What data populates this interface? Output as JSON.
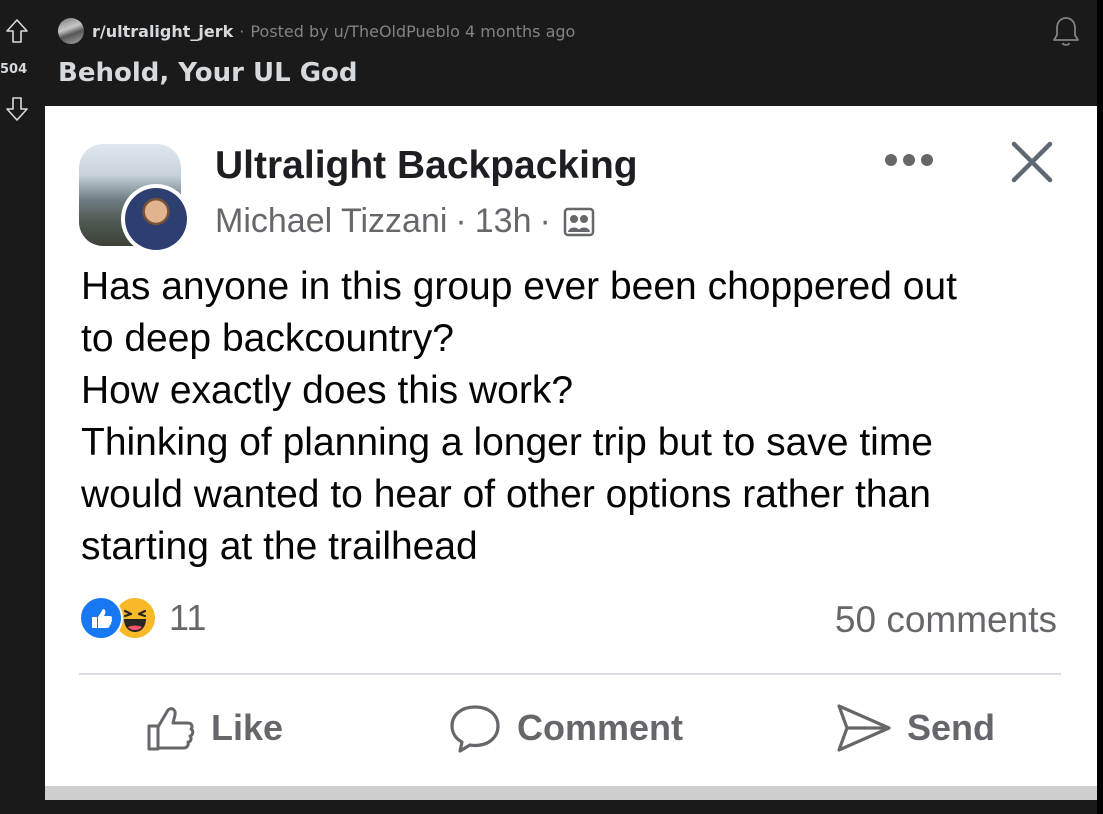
{
  "reddit": {
    "subreddit": "r/ultralight_jerk",
    "meta_sep": "·",
    "posted_by": "Posted by u/TheOldPueblo 4 months ago",
    "score": "504",
    "title": "Behold, Your UL God"
  },
  "fb_post": {
    "group_name": "Ultralight Backpacking",
    "author": "Michael Tizzani",
    "sep": "·",
    "time": "13h",
    "body": "Has anyone in this group ever been choppered out\nto deep backcountry?\nHow exactly does this work?\nThinking of planning a longer trip but to save time\nwould wanted to hear of other options rather than\nstarting at the trailhead",
    "reaction_count": "11",
    "comment_count": "50 comments",
    "actions": {
      "like": "Like",
      "comment": "Comment",
      "send": "Send"
    }
  },
  "icons": [
    "upvote-icon",
    "downvote-icon",
    "bell-icon",
    "more-icon",
    "close-icon",
    "group-audience-icon",
    "like-reaction-icon",
    "haha-reaction-icon",
    "thumbs-up-icon",
    "comment-icon",
    "send-icon"
  ],
  "colors": {
    "reddit_bg": "#1a1a1b",
    "fb_blue": "#1877f2",
    "haha_yellow": "#f7b928",
    "fb_gray": "#65676b"
  }
}
